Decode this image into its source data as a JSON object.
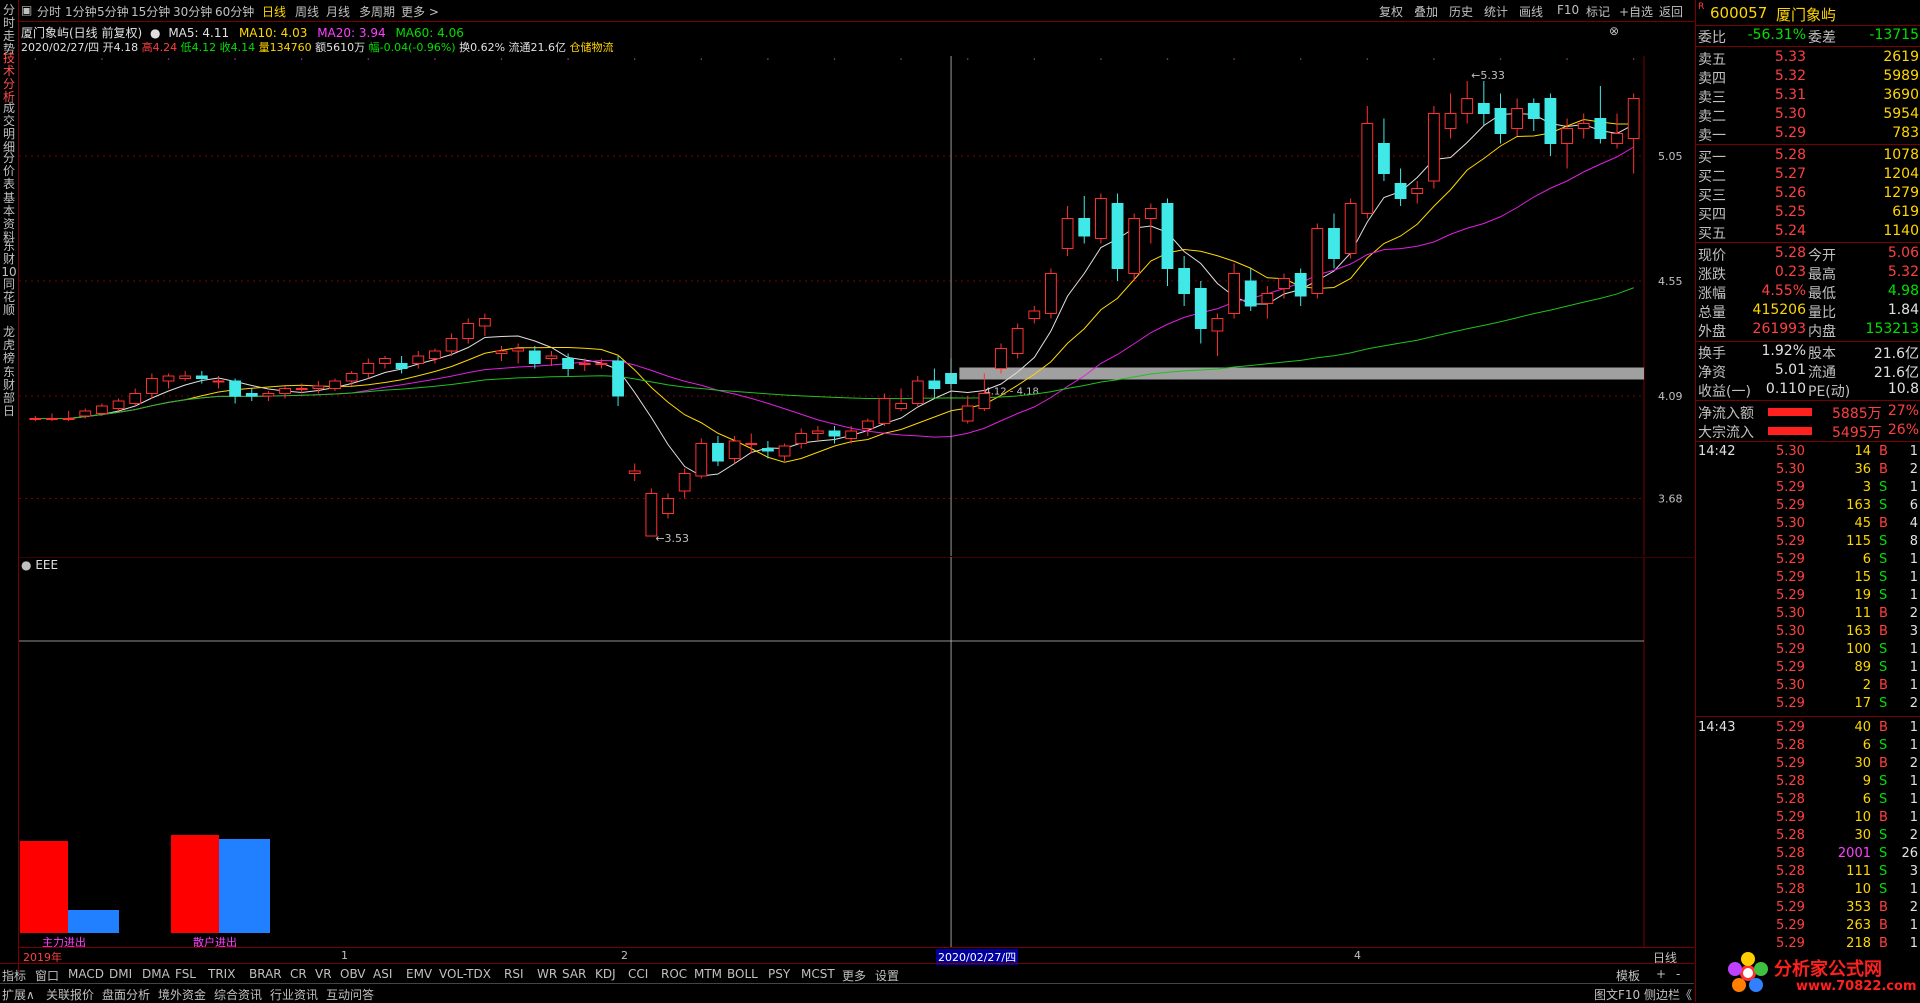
{
  "left_tabs": [
    "分时走势",
    "技术分析",
    "成交明细",
    "分价表",
    "基本资料",
    "东财10",
    "同花顺",
    "龙虎榜",
    "东财部日"
  ],
  "period_tabs": [
    "分时",
    "1分钟",
    "5分钟",
    "15分钟",
    "30分钟",
    "60分钟",
    "日线",
    "周线",
    "月线",
    "多周期",
    "更多 >"
  ],
  "right_buttons": [
    "复权",
    "叠加",
    "历史",
    "统计",
    "画线",
    "F10",
    "标记",
    "+自选",
    "返回"
  ],
  "info": {
    "title": "厦门象屿(日线 前复权)",
    "ma5": "MA5: 4.11",
    "ma10": "MA10: 4.03",
    "ma20": "MA20: 3.94",
    "ma60": "MA60: 4.06",
    "date": "2020/02/27/四",
    "open": "开4.18",
    "high": "高4.24",
    "low": "低4.12",
    "close": "收4.14",
    "vol": "量134760",
    "amt": "额5610万",
    "chg": "幅-0.04(-0.96%)",
    "turn": "换0.62%",
    "float": "流通21.6亿",
    "sector": "仓储物流"
  },
  "price_axis": [
    "5.05",
    "4.55",
    "4.09",
    "3.68"
  ],
  "annotations": {
    "high": "5.33",
    "low": "3.53",
    "band": "4.12 - 4.18"
  },
  "indicator": {
    "name": "EEE",
    "label_main": "主力进出",
    "label_retail": "散户进出",
    "bars": [
      [
        0.92,
        0.23
      ],
      [
        0.98,
        0.94
      ]
    ]
  },
  "date_axis": {
    "year": "2019年",
    "m1": "1",
    "m2": "2",
    "cursor": "2020/02/27/四",
    "m4": "4",
    "period": "日线"
  },
  "indicator_tabs": [
    "指标",
    "窗口",
    "MACD",
    "DMI",
    "DMA",
    "FSL",
    "TRIX",
    "BRAR",
    "CR",
    "VR",
    "OBV",
    "ASI",
    "EMV",
    "VOL-TDX",
    "RSI",
    "WR",
    "SAR",
    "KDJ",
    "CCI",
    "ROC",
    "MTM",
    "BOLL",
    "PSY",
    "MCST",
    "更多",
    "设置",
    "模板",
    "+",
    "-"
  ],
  "bottom_tabs": [
    "扩展∧",
    "关联报价",
    "盘面分析",
    "境外资金",
    "综合资讯",
    "行业资讯",
    "互动问答"
  ],
  "bottom_right": "图文F10 侧边栏《",
  "quote": {
    "code": "600057",
    "name": "厦门象屿",
    "flag": "R",
    "weibi": "委比",
    "weibi_v": "-56.31%",
    "weicha": "委差",
    "weicha_v": "-13715",
    "asks": [
      [
        "卖五",
        "5.33",
        "2619"
      ],
      [
        "卖四",
        "5.32",
        "5989"
      ],
      [
        "卖三",
        "5.31",
        "3690"
      ],
      [
        "卖二",
        "5.30",
        "5954"
      ],
      [
        "卖一",
        "5.29",
        "783"
      ]
    ],
    "bids": [
      [
        "买一",
        "5.28",
        "1078"
      ],
      [
        "买二",
        "5.27",
        "1204"
      ],
      [
        "买三",
        "5.26",
        "1279"
      ],
      [
        "买四",
        "5.25",
        "619"
      ],
      [
        "买五",
        "5.24",
        "1140"
      ]
    ],
    "stats": [
      [
        "现价",
        "5.28",
        "今开",
        "5.06"
      ],
      [
        "涨跌",
        "0.23",
        "最高",
        "5.32"
      ],
      [
        "涨幅",
        "4.55%",
        "最低",
        "4.98"
      ],
      [
        "总量",
        "415206",
        "量比",
        "1.84"
      ],
      [
        "外盘",
        "261993",
        "内盘",
        "153213"
      ],
      [
        "换手",
        "1.92%",
        "股本",
        "21.6亿"
      ],
      [
        "净资",
        "5.01",
        "流通",
        "21.6亿"
      ],
      [
        "收益(一)",
        "0.110",
        "PE(动)",
        "10.8"
      ]
    ],
    "flows": [
      [
        "净流入额",
        "5885万",
        "27%"
      ],
      [
        "大宗流入",
        "5495万",
        "26%"
      ]
    ],
    "ticks_1442": [
      [
        "5.30",
        "14",
        "B",
        "1"
      ],
      [
        "5.30",
        "36",
        "B",
        "2"
      ],
      [
        "5.29",
        "3",
        "S",
        "1"
      ],
      [
        "5.29",
        "163",
        "S",
        "6"
      ],
      [
        "5.30",
        "45",
        "B",
        "4"
      ],
      [
        "5.29",
        "115",
        "S",
        "8"
      ],
      [
        "5.29",
        "6",
        "S",
        "1"
      ],
      [
        "5.29",
        "15",
        "S",
        "1"
      ],
      [
        "5.29",
        "19",
        "S",
        "1"
      ],
      [
        "5.30",
        "11",
        "B",
        "2"
      ],
      [
        "5.30",
        "163",
        "B",
        "3"
      ],
      [
        "5.29",
        "100",
        "S",
        "1"
      ],
      [
        "5.29",
        "89",
        "S",
        "1"
      ],
      [
        "5.30",
        "2",
        "B",
        "1"
      ],
      [
        "5.29",
        "17",
        "S",
        "2"
      ]
    ],
    "ticks_1443": [
      [
        "5.29",
        "40",
        "B",
        "1"
      ],
      [
        "5.28",
        "6",
        "S",
        "1"
      ],
      [
        "5.29",
        "30",
        "B",
        "2"
      ],
      [
        "5.28",
        "9",
        "S",
        "1"
      ],
      [
        "5.28",
        "6",
        "S",
        "1"
      ],
      [
        "5.29",
        "10",
        "B",
        "1"
      ],
      [
        "5.28",
        "30",
        "S",
        "2"
      ],
      [
        "5.28",
        "2001",
        "S",
        "26"
      ],
      [
        "5.28",
        "111",
        "S",
        "3"
      ],
      [
        "5.28",
        "10",
        "S",
        "1"
      ],
      [
        "5.29",
        "353",
        "B",
        "2"
      ],
      [
        "5.29",
        "263",
        "B",
        "1"
      ],
      [
        "5.29",
        "218",
        "B",
        "1"
      ]
    ],
    "time1": "14:42",
    "time2": "14:43"
  },
  "logo": {
    "text": "分析家公式网",
    "url": "www.70822.com"
  },
  "chart_data": {
    "type": "candlestick",
    "ylim": [
      3.45,
      5.45
    ],
    "candles": [
      [
        4.0,
        4.01,
        4.0,
        3.99
      ],
      [
        4.0,
        4.02,
        4.0,
        3.99
      ],
      [
        4.0,
        4.03,
        4.0,
        3.99
      ],
      [
        4.01,
        4.04,
        4.03,
        4.0
      ],
      [
        4.02,
        4.06,
        4.05,
        4.01
      ],
      [
        4.04,
        4.08,
        4.07,
        4.03
      ],
      [
        4.06,
        4.12,
        4.1,
        4.05
      ],
      [
        4.1,
        4.18,
        4.16,
        4.08
      ],
      [
        4.15,
        4.18,
        4.17,
        4.12
      ],
      [
        4.16,
        4.19,
        4.17,
        4.15
      ],
      [
        4.17,
        4.19,
        4.16,
        4.14
      ],
      [
        4.15,
        4.17,
        4.15,
        4.12
      ],
      [
        4.15,
        4.16,
        4.09,
        4.06
      ],
      [
        4.1,
        4.12,
        4.09,
        4.07
      ],
      [
        4.09,
        4.11,
        4.1,
        4.07
      ],
      [
        4.1,
        4.13,
        4.12,
        4.08
      ],
      [
        4.12,
        4.14,
        4.12,
        4.1
      ],
      [
        4.12,
        4.15,
        4.13,
        4.1
      ],
      [
        4.12,
        4.16,
        4.15,
        4.11
      ],
      [
        4.15,
        4.19,
        4.18,
        4.13
      ],
      [
        4.18,
        4.24,
        4.22,
        4.16
      ],
      [
        4.22,
        4.25,
        4.24,
        4.2
      ],
      [
        4.22,
        4.25,
        4.2,
        4.18
      ],
      [
        4.22,
        4.27,
        4.25,
        4.2
      ],
      [
        4.24,
        4.28,
        4.27,
        4.22
      ],
      [
        4.27,
        4.34,
        4.32,
        4.25
      ],
      [
        4.32,
        4.4,
        4.38,
        4.3
      ],
      [
        4.37,
        4.42,
        4.4,
        4.33
      ],
      [
        4.26,
        4.29,
        4.27,
        4.23
      ],
      [
        4.27,
        4.3,
        4.28,
        4.22
      ],
      [
        4.27,
        4.29,
        4.22,
        4.2
      ],
      [
        4.24,
        4.27,
        4.25,
        4.21
      ],
      [
        4.24,
        4.26,
        4.2,
        4.17
      ],
      [
        4.22,
        4.24,
        4.22,
        4.19
      ],
      [
        4.22,
        4.24,
        4.22,
        4.2
      ],
      [
        4.23,
        4.25,
        4.09,
        4.05
      ],
      [
        3.78,
        3.82,
        3.79,
        3.75
      ],
      [
        3.53,
        3.72,
        3.7,
        3.53
      ],
      [
        3.62,
        3.7,
        3.68,
        3.6
      ],
      [
        3.71,
        3.8,
        3.78,
        3.68
      ],
      [
        3.77,
        3.92,
        3.9,
        3.76
      ],
      [
        3.9,
        3.93,
        3.83,
        3.81
      ],
      [
        3.84,
        3.93,
        3.91,
        3.82
      ],
      [
        3.9,
        3.94,
        3.9,
        3.86
      ],
      [
        3.88,
        3.91,
        3.87,
        3.84
      ],
      [
        3.85,
        3.9,
        3.89,
        3.83
      ],
      [
        3.9,
        3.96,
        3.94,
        3.88
      ],
      [
        3.94,
        3.97,
        3.95,
        3.91
      ],
      [
        3.95,
        3.97,
        3.93,
        3.9
      ],
      [
        3.92,
        3.97,
        3.95,
        3.9
      ],
      [
        3.96,
        4.0,
        3.99,
        3.93
      ],
      [
        3.98,
        4.1,
        4.08,
        3.97
      ],
      [
        4.04,
        4.12,
        4.06,
        4.03
      ],
      [
        4.06,
        4.17,
        4.15,
        4.05
      ],
      [
        4.15,
        4.2,
        4.12,
        4.08
      ],
      [
        4.18,
        4.24,
        4.14,
        4.12
      ],
      [
        3.99,
        4.09,
        4.05,
        3.98
      ],
      [
        4.04,
        4.18,
        4.1,
        4.03
      ],
      [
        4.2,
        4.3,
        4.28,
        4.18
      ],
      [
        4.26,
        4.38,
        4.36,
        4.24
      ],
      [
        4.4,
        4.45,
        4.43,
        4.38
      ],
      [
        4.42,
        4.6,
        4.58,
        4.4
      ],
      [
        4.68,
        4.85,
        4.8,
        4.65
      ],
      [
        4.8,
        4.89,
        4.73,
        4.7
      ],
      [
        4.72,
        4.9,
        4.88,
        4.7
      ],
      [
        4.86,
        4.9,
        4.6,
        4.55
      ],
      [
        4.58,
        4.82,
        4.8,
        4.55
      ],
      [
        4.8,
        4.86,
        4.84,
        4.7
      ],
      [
        4.86,
        4.88,
        4.6,
        4.53
      ],
      [
        4.6,
        4.65,
        4.5,
        4.45
      ],
      [
        4.52,
        4.55,
        4.36,
        4.3
      ],
      [
        4.35,
        4.42,
        4.4,
        4.25
      ],
      [
        4.42,
        4.62,
        4.58,
        4.4
      ],
      [
        4.55,
        4.6,
        4.45,
        4.43
      ],
      [
        4.46,
        4.53,
        4.5,
        4.4
      ],
      [
        4.52,
        4.58,
        4.56,
        4.48
      ],
      [
        4.58,
        4.6,
        4.49,
        4.45
      ],
      [
        4.5,
        4.78,
        4.76,
        4.48
      ],
      [
        4.76,
        4.82,
        4.64,
        4.6
      ],
      [
        4.66,
        4.88,
        4.86,
        4.64
      ],
      [
        4.82,
        5.25,
        5.18,
        4.8
      ],
      [
        5.1,
        5.2,
        4.98,
        4.95
      ],
      [
        4.94,
        5.0,
        4.88,
        4.85
      ],
      [
        4.9,
        4.95,
        4.92,
        4.86
      ],
      [
        4.95,
        5.25,
        5.22,
        4.92
      ],
      [
        5.16,
        5.3,
        5.22,
        5.12
      ],
      [
        5.22,
        5.35,
        5.28,
        5.18
      ],
      [
        5.26,
        5.35,
        5.22,
        5.17
      ],
      [
        5.24,
        5.3,
        5.14,
        5.1
      ],
      [
        5.16,
        5.28,
        5.24,
        5.13
      ],
      [
        5.26,
        5.28,
        5.2,
        5.15
      ],
      [
        5.28,
        5.3,
        5.1,
        5.05
      ],
      [
        5.1,
        5.2,
        5.16,
        5.0
      ],
      [
        5.16,
        5.22,
        5.18,
        5.12
      ],
      [
        5.2,
        5.33,
        5.12,
        5.1
      ],
      [
        5.1,
        5.22,
        5.14,
        5.08
      ],
      [
        5.12,
        5.3,
        5.28,
        4.98
      ]
    ]
  }
}
